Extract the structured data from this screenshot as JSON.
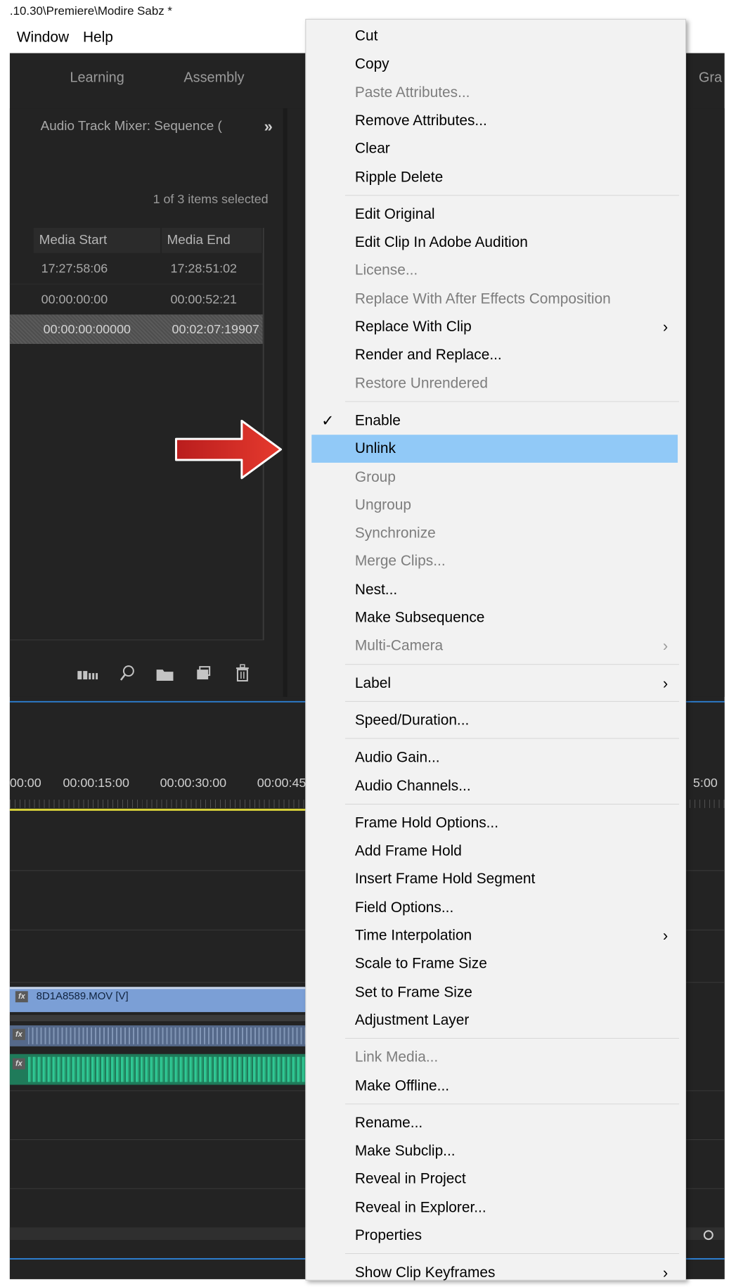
{
  "title_bar": {
    "text": ".10.30\\Premiere\\Modire Sabz *"
  },
  "menubar": [
    "Window",
    "Help"
  ],
  "workspace_tabs": [
    "Learning",
    "Assembly",
    "Gra"
  ],
  "project_panel": {
    "tab_label": "Audio Track Mixer: Sequence (",
    "overflow": "»",
    "selection_count": "1 of 3 items selected",
    "columns": [
      "Media Start",
      "Media End"
    ],
    "rows": [
      [
        "17:27:58:06",
        "17:28:51:02"
      ],
      [
        "00:00:00:00",
        "00:00:52:21"
      ],
      [
        "00:00:00:00000",
        "00:02:07:19907"
      ]
    ],
    "tools": [
      "freeform-view-icon",
      "find-icon",
      "new-bin-icon",
      "new-item-icon",
      "clear-trash-icon"
    ]
  },
  "timeline": {
    "timecodes": [
      "00:00",
      "00:00:15:00",
      "00:00:30:00",
      "00:00:45",
      "5:00"
    ],
    "video_clip": {
      "fx": "fx",
      "label": "8D1A8589.MOV [V]"
    },
    "audio_fx": [
      "fx",
      "fx"
    ]
  },
  "context_menu": {
    "highlight_color": "#91c9f7",
    "groups": [
      [
        {
          "label": "Cut"
        },
        {
          "label": "Copy"
        },
        {
          "label": "Paste Attributes...",
          "disabled": true
        },
        {
          "label": "Remove Attributes..."
        },
        {
          "label": "Clear"
        },
        {
          "label": "Ripple Delete"
        }
      ],
      [
        {
          "label": "Edit Original"
        },
        {
          "label": "Edit Clip In Adobe Audition"
        },
        {
          "label": "License...",
          "disabled": true
        },
        {
          "label": "Replace With After Effects Composition",
          "disabled": true
        },
        {
          "label": "Replace With Clip",
          "submenu": true
        },
        {
          "label": "Render and Replace..."
        },
        {
          "label": "Restore Unrendered",
          "disabled": true
        }
      ],
      [
        {
          "label": "Enable",
          "checked": true
        },
        {
          "label": "Unlink",
          "highlighted": true
        },
        {
          "label": "Group",
          "disabled": true
        },
        {
          "label": "Ungroup",
          "disabled": true
        },
        {
          "label": "Synchronize",
          "disabled": true
        },
        {
          "label": "Merge Clips...",
          "disabled": true
        },
        {
          "label": "Nest..."
        },
        {
          "label": "Make Subsequence"
        },
        {
          "label": "Multi-Camera",
          "disabled": true,
          "submenu": true
        }
      ],
      [
        {
          "label": "Label",
          "submenu": true
        }
      ],
      [
        {
          "label": "Speed/Duration..."
        }
      ],
      [
        {
          "label": "Audio Gain..."
        },
        {
          "label": "Audio Channels..."
        }
      ],
      [
        {
          "label": "Frame Hold Options..."
        },
        {
          "label": "Add Frame Hold"
        },
        {
          "label": "Insert Frame Hold Segment"
        },
        {
          "label": "Field Options..."
        },
        {
          "label": "Time Interpolation",
          "submenu": true
        },
        {
          "label": "Scale to Frame Size"
        },
        {
          "label": "Set to Frame Size"
        },
        {
          "label": "Adjustment Layer"
        }
      ],
      [
        {
          "label": "Link Media...",
          "disabled": true
        },
        {
          "label": "Make Offline..."
        }
      ],
      [
        {
          "label": "Rename..."
        },
        {
          "label": "Make Subclip..."
        },
        {
          "label": "Reveal in Project"
        },
        {
          "label": "Reveal in Explorer..."
        },
        {
          "label": "Properties"
        }
      ],
      [
        {
          "label": "Show Clip Keyframes",
          "submenu": true
        }
      ]
    ]
  }
}
